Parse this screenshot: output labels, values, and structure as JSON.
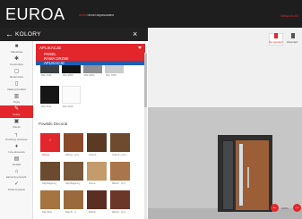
{
  "header": {
    "logo": "EUROA",
    "tagline_accent": "okna",
    "tagline_rest": "i drzwi dopasowane",
    "project": "Bełęcza 50"
  },
  "panel": {
    "title": "KOLORY",
    "dropdown_value": "APLIKACJE",
    "options": [
      "PANEL",
      "RAMA DRZWI",
      "APLIKACJE"
    ],
    "section_title": "Powłoki Decoral"
  },
  "nav": [
    {
      "icon": "home-icon",
      "label": "Nabudowa"
    },
    {
      "icon": "gear-icon",
      "label": "Konstrukcja"
    },
    {
      "icon": "window-icon",
      "label": "Model drzwi"
    },
    {
      "icon": "door-icon",
      "label": "Układ przeszkleń"
    },
    {
      "icon": "panel-icon",
      "label": "Szyby"
    },
    {
      "icon": "brush-icon",
      "label": "Kolory"
    },
    {
      "icon": "frame-icon",
      "label": "Klamki"
    },
    {
      "icon": "handle-icon",
      "label": "Pochwyty drzwiowe"
    },
    {
      "icon": "lock-icon",
      "label": "Inne akcesoria"
    },
    {
      "icon": "glass-icon",
      "label": "Dodatki"
    },
    {
      "icon": "tools-icon",
      "label": "Elementy przeszk."
    },
    {
      "icon": "check-icon",
      "label": "Podsumowanie"
    }
  ],
  "swatches_top": [
    "RAL 7016",
    "RAL 9005",
    "RAL 9006",
    "RAL 7035",
    "RAL 9011",
    "RAL 9016"
  ],
  "swatches_decoral": [
    "Wiśnia",
    "Wiśnia - przy...",
    "Orzech",
    "Orzech - przy...",
    "Dąb Bagienny",
    "Dąb Bagienny",
    "Sosna",
    "Mahoń - przy...",
    "Dąb Złoty",
    "Dąb Zł - p...",
    "Mahoń",
    "Mahoń - przy..."
  ],
  "viewer": {
    "view_outside": "Na zewnątrz",
    "view_inside": "Wewnątrz",
    "zoom": "100%"
  },
  "colors": {
    "brand_red": "#e3262b",
    "selected_option_blue": "#1e5fb4",
    "dark_bar": "#1e1e1e"
  }
}
